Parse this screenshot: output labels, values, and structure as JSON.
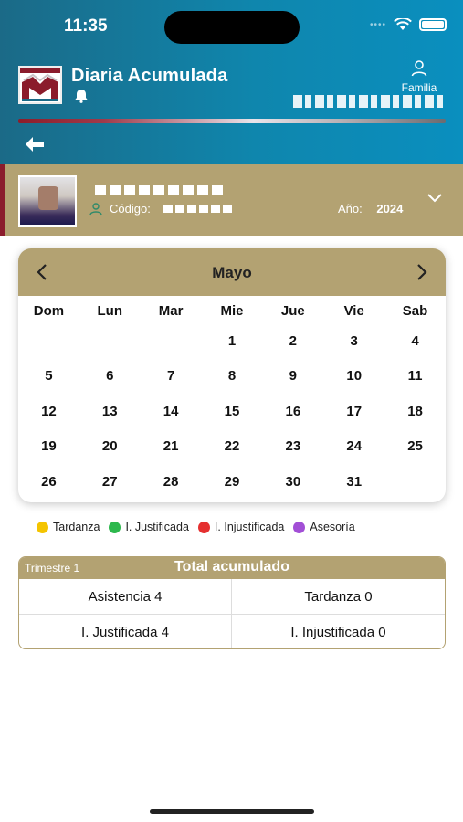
{
  "status_bar": {
    "time": "11:35",
    "signal_icon": "signal-dots-icon",
    "wifi_icon": "wifi-icon",
    "battery_icon": "battery-icon"
  },
  "header": {
    "title": "Diaria Acumulada",
    "bell_icon": "bell-icon",
    "family_label": "Familia",
    "logo": "school-logo",
    "back_icon": "arrow-left-icon",
    "colors": {
      "gradient_start": "#1b6a87",
      "gradient_end": "#0a8fbf",
      "accent_gold": "#b3a272",
      "accent_red": "#8b1c2c"
    }
  },
  "student": {
    "code_label": "Código:",
    "year_label": "Año:",
    "year_value": "2024"
  },
  "calendar": {
    "month": "Mayo",
    "weekdays": [
      "Dom",
      "Lun",
      "Mar",
      "Mie",
      "Jue",
      "Vie",
      "Sab"
    ],
    "days": [
      "",
      "",
      "",
      "1",
      "2",
      "3",
      "4",
      "5",
      "6",
      "7",
      "8",
      "9",
      "10",
      "11",
      "12",
      "13",
      "14",
      "15",
      "16",
      "17",
      "18",
      "19",
      "20",
      "21",
      "22",
      "23",
      "24",
      "25",
      "26",
      "27",
      "28",
      "29",
      "30",
      "31",
      ""
    ]
  },
  "legend": [
    {
      "label": "Tardanza",
      "color": "#f4c400"
    },
    {
      "label": "I. Justificada",
      "color": "#2db84d"
    },
    {
      "label": "I. Injustificada",
      "color": "#e53030"
    },
    {
      "label": "Asesoría",
      "color": "#a24fd6"
    }
  ],
  "summary": {
    "trimester": "Trimestre 1",
    "title": "Total acumulado",
    "cells": [
      "Asistencia 4",
      "Tardanza 0",
      "I. Justificada 4",
      "I. Injustificada 0"
    ]
  }
}
